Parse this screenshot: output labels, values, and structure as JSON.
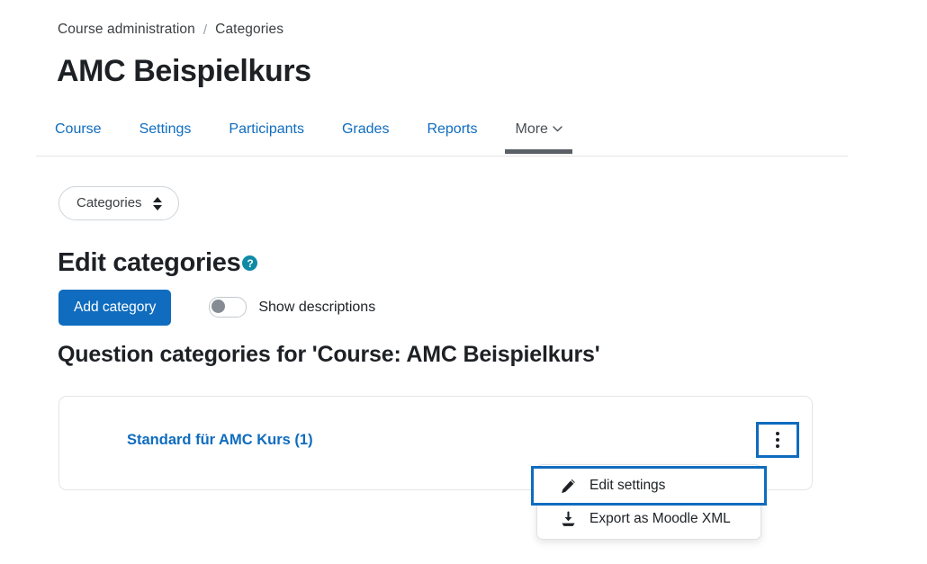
{
  "breadcrumb": {
    "items": [
      "Course administration",
      "Categories"
    ],
    "separator": "/"
  },
  "page": {
    "title": "AMC Beispielkurs"
  },
  "tabs": [
    {
      "label": "Course",
      "active": false
    },
    {
      "label": "Settings",
      "active": false
    },
    {
      "label": "Participants",
      "active": false
    },
    {
      "label": "Grades",
      "active": false
    },
    {
      "label": "Reports",
      "active": false
    },
    {
      "label": "More",
      "active": true,
      "chevron": "⌄"
    }
  ],
  "select": {
    "value": "Categories"
  },
  "edit_categories": {
    "heading": "Edit categories",
    "help_icon_label": "?"
  },
  "actions": {
    "add_category_label": "Add category",
    "show_descriptions_label": "Show descriptions",
    "show_descriptions_on": false
  },
  "section": {
    "heading": "Question categories for 'Course: AMC Beispielkurs'"
  },
  "category": {
    "name": "Standard für AMC Kurs (1)",
    "menu_icon": "kebab-menu-icon"
  },
  "menu": {
    "items": [
      {
        "label": "Edit settings",
        "icon": "pencil-icon",
        "focused": true
      },
      {
        "label": "Export as Moodle XML",
        "icon": "download-icon",
        "focused": false
      }
    ]
  },
  "colors": {
    "primary_blue": "#0f6cbf",
    "help_teal": "#0f8aa5",
    "text_dark": "#1d2125",
    "active_tab_underline": "#5b6066",
    "card_border": "#e3e5e8"
  }
}
